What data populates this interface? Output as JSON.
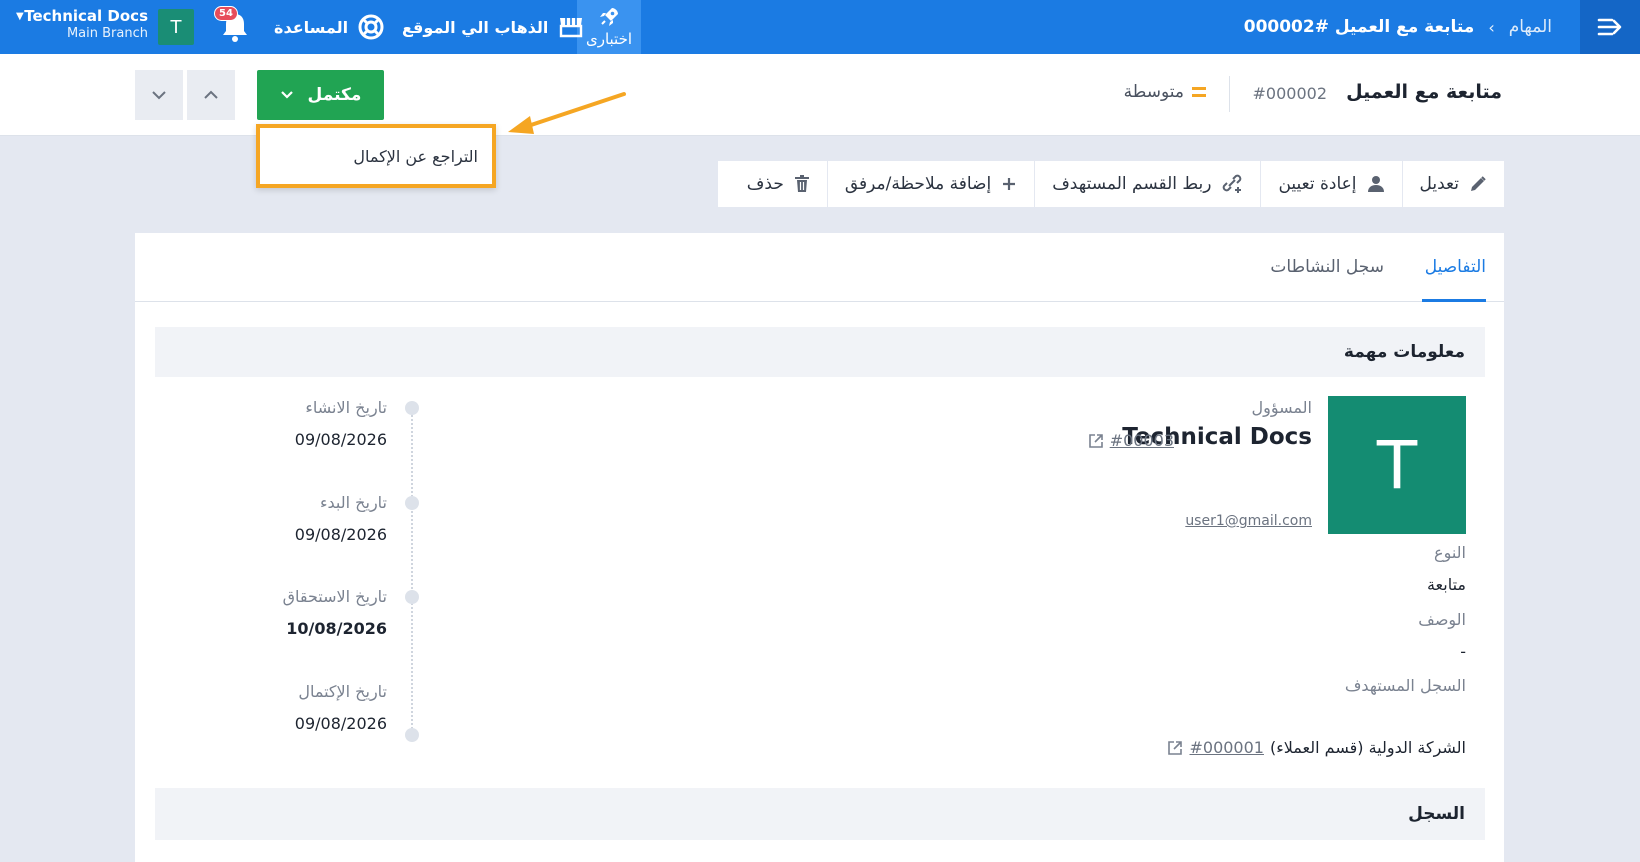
{
  "topbar": {
    "breadcrumb_root": "المهام",
    "breadcrumb_current": "متابعة مع العميل #000002",
    "try_label": "اختبارى",
    "go_to_site_label": "الذهاب الي الموقع",
    "help_label": "المساعدة",
    "notifications_count": "54",
    "avatar_letter": "T",
    "account_name": "Technical Docs",
    "account_branch": "Main Branch"
  },
  "header": {
    "title": "متابعة مع العميل",
    "task_id": "#000002",
    "priority_label": "متوسطة",
    "status_label": "مكتمل"
  },
  "dropdown": {
    "undo_complete_label": "التراجع عن الإكمال"
  },
  "toolbar": {
    "edit": "تعديل",
    "reassign": "إعادة تعيين",
    "link_target": "ربط القسم المستهدف",
    "add_note": "إضافة ملاحظة/مرفق",
    "delete": "حذف"
  },
  "tabs": {
    "details": "التفاصيل",
    "activity_log": "سجل النشاطات"
  },
  "important_info": {
    "section_title": "معلومات مهمة",
    "owner_label": "المسؤول",
    "owner_avatar_letter": "T",
    "owner_name": "Technical Docs",
    "owner_id": "#00003",
    "owner_email": "user1@gmail.com",
    "type_label": "النوع",
    "type_value": "متابعة",
    "description_label": "الوصف",
    "description_value": "-",
    "target_record_label": "السجل المستهدف",
    "target_record_id": "#000001",
    "target_record_text": "(قسم العملاء) الشركة الدولية"
  },
  "timeline": {
    "created_label": "تاريخ الانشاء",
    "created_value": "09/08/2026",
    "start_label": "تاريخ البدء",
    "start_value": "09/08/2026",
    "due_label": "تاريخ الاستحقاق",
    "due_value": "10/08/2026",
    "completed_label": "تاريخ الإكتمال",
    "completed_value": "09/08/2026"
  },
  "log": {
    "section_title": "السجل"
  },
  "colors": {
    "primary": "#1b7be3",
    "success": "#21a453",
    "callout": "#f5a623",
    "avatar": "#148c72"
  }
}
